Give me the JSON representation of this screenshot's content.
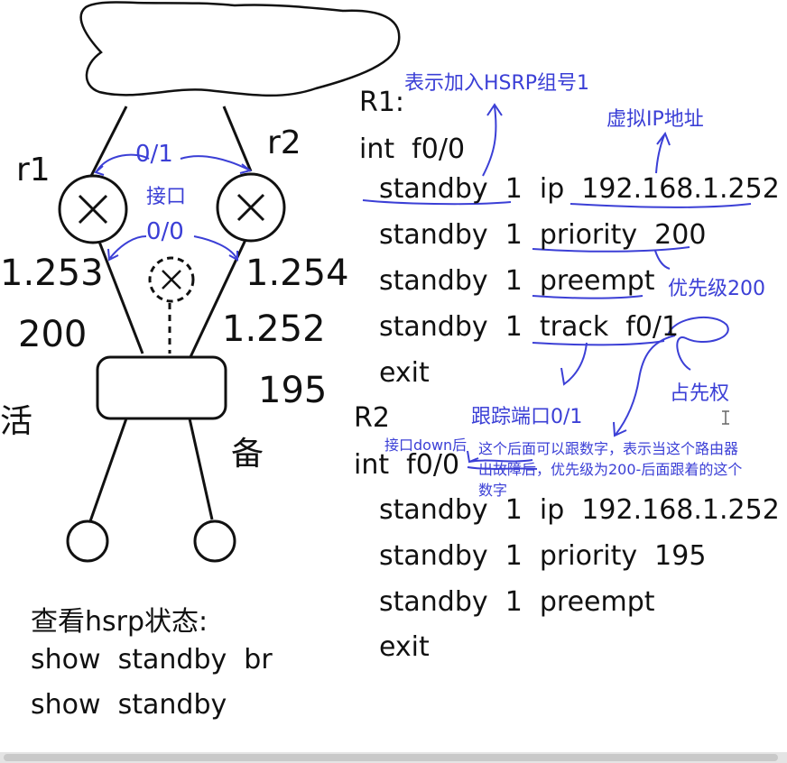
{
  "diagram": {
    "router_left": "r1",
    "router_right": "r2",
    "port_top": "0/1",
    "interface_note": "接口",
    "port_bottom": "0/0",
    "ip_left": "1.253",
    "priority_left": "200",
    "ip_right": "1.254",
    "virtual_ip": "1.252",
    "priority_right": "195",
    "state_active": "活",
    "state_standby": "备"
  },
  "status": {
    "heading": "查看hsrp状态:",
    "cmd1": "show  standby  br",
    "cmd2": "show  standby"
  },
  "r1": {
    "title": "R1:",
    "lines": [
      "int  f0/0",
      "standby  1  ip  192.168.1.252",
      "standby  1  priority  200",
      "standby  1  preempt",
      "standby  1  track  f0/1",
      "exit"
    ]
  },
  "r2": {
    "title": "R2",
    "lines": [
      "int  f0/0",
      "standby  1  ip  192.168.1.252",
      "standby  1  priority  195",
      "standby  1  preempt",
      "exit"
    ]
  },
  "annotations": {
    "group": "表示加入HSRP组号1",
    "virtual_ip": "虚拟IP地址",
    "priority": "优先级200",
    "preempt": "占先权",
    "track": "跟踪端口0/1",
    "if_down": "接口down后",
    "explain1": "这个后面可以跟数字，表示当这个路由器",
    "explain2": "出故障后，优先级为200-后面跟着的这个",
    "explain3": "数字"
  },
  "colors": {
    "ink": "#111111",
    "annotation_blue": "#3b3fd6"
  }
}
